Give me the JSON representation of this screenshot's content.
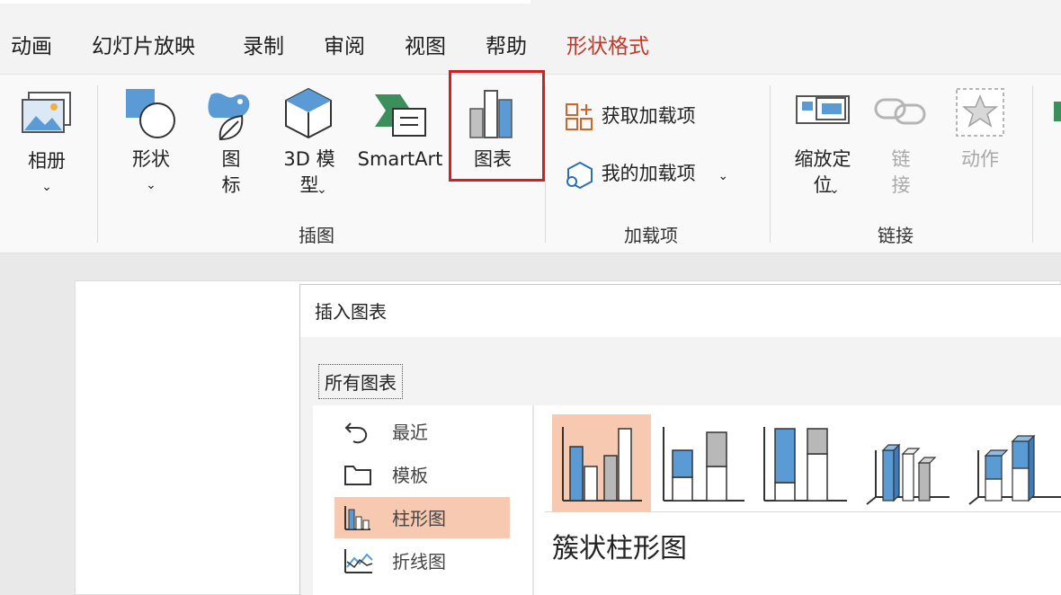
{
  "menu": {
    "tabs": [
      {
        "label": "动画"
      },
      {
        "label": "幻灯片放映"
      },
      {
        "label": "录制"
      },
      {
        "label": "审阅"
      },
      {
        "label": "视图"
      },
      {
        "label": "帮助"
      },
      {
        "label": "形状格式"
      }
    ],
    "active_tab": "形状格式"
  },
  "ribbon": {
    "album": {
      "label": "相册"
    },
    "illustrations": {
      "shapes_label": "形状",
      "icons_label": "图\n标",
      "model3d_label": "3D 模\n型",
      "smartart_label": "SmartArt",
      "chart_label": "图表",
      "group_label": "插图"
    },
    "addins": {
      "get_label": "获取加载项",
      "my_label": "我的加载项",
      "group_label": "加载项"
    },
    "links": {
      "zoom_label": "缩放定\n位",
      "link_label": "链\n接",
      "action_label": "动作",
      "group_label": "链接"
    },
    "accent_color": "#d22020"
  },
  "dialog": {
    "title": "插入图表",
    "all_charts_tab": "所有图表",
    "categories": [
      {
        "label": "最近",
        "icon": "undo-icon"
      },
      {
        "label": "模板",
        "icon": "folder-icon"
      },
      {
        "label": "柱形图",
        "icon": "column-chart-icon",
        "selected": true
      },
      {
        "label": "折线图",
        "icon": "line-chart-icon"
      }
    ],
    "subtype_name": "簇状柱形图",
    "selection_color": "#f7c9b0",
    "bar_color": "#5b9bd5"
  }
}
